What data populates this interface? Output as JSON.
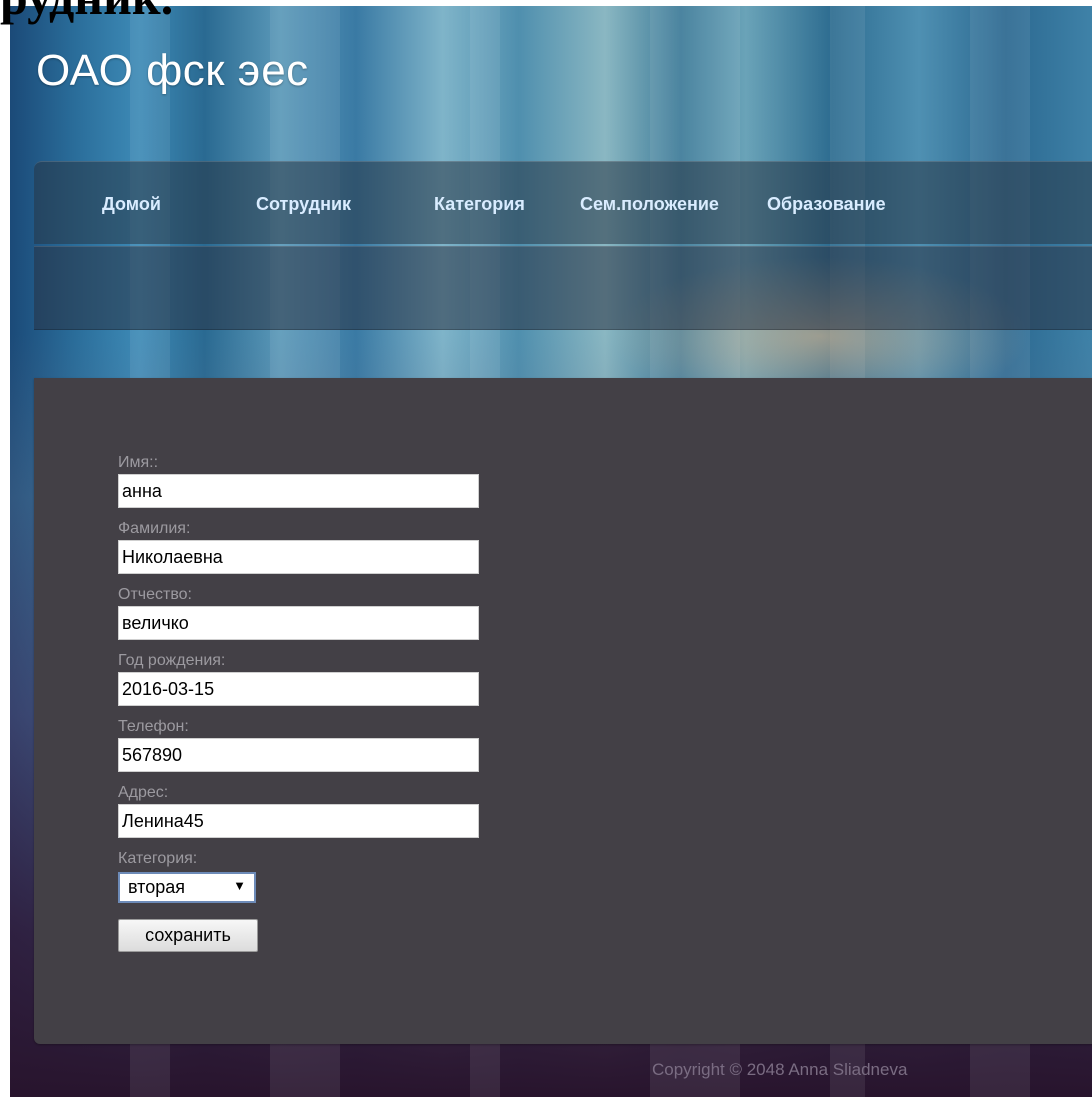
{
  "page": {
    "top_cut_text": "рудник.",
    "site_title": "ОАО фск эес"
  },
  "nav": {
    "items": [
      {
        "label": "Домой"
      },
      {
        "label": "Сотрудник"
      },
      {
        "label": "Категория"
      },
      {
        "label": "Сем.положение"
      },
      {
        "label": "Образование"
      }
    ]
  },
  "form": {
    "first_name": {
      "label": "Имя::",
      "value": "анна"
    },
    "last_name": {
      "label": "Фамилия:",
      "value": "Николаевна"
    },
    "patronymic": {
      "label": "Отчество:",
      "value": "величко"
    },
    "birth_year": {
      "label": "Год рождения:",
      "value": "2016-03-15"
    },
    "phone": {
      "label": "Телефон:",
      "value": "567890"
    },
    "address": {
      "label": "Адрес:",
      "value": "Ленина45"
    },
    "category": {
      "label": "Категория:",
      "selected": "вторая",
      "arrow": "▼"
    },
    "save_label": "сохранить"
  },
  "footer": {
    "copyright": "Copyright © 2048 Anna Sliadneva"
  }
}
